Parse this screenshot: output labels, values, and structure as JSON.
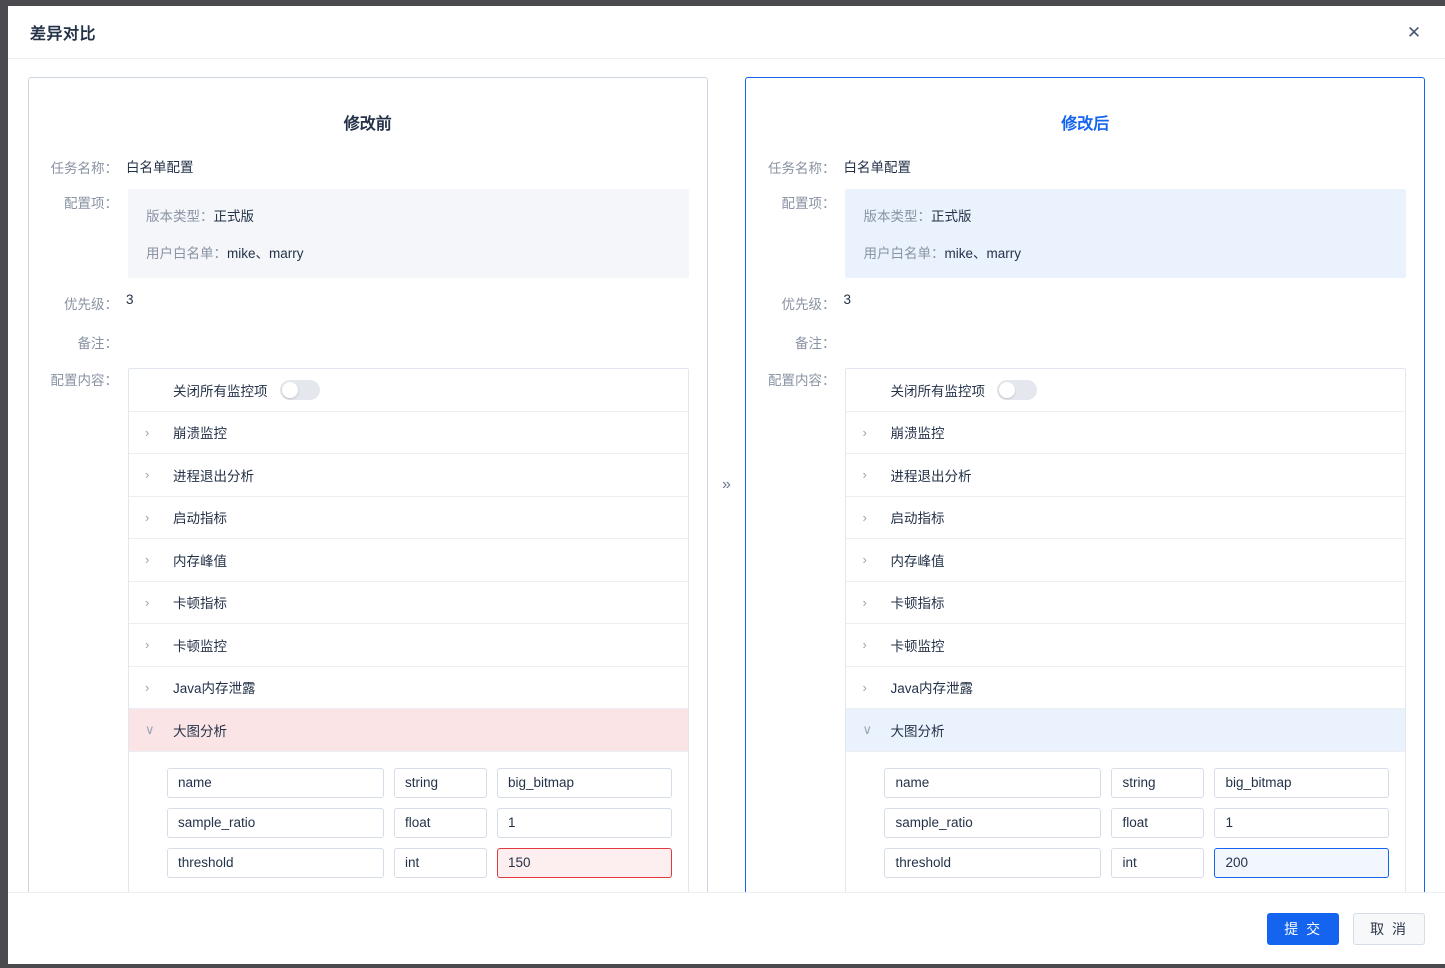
{
  "dialog": {
    "title": "差异对比",
    "close_icon": "close-icon",
    "separator_icon": "double-chevron-right-icon"
  },
  "footer": {
    "submit_label": "提 交",
    "cancel_label": "取 消"
  },
  "colors": {
    "accent_blue": "#1464f0",
    "diff_removed_bg": "#fbe4e6",
    "diff_removed_border": "#e0393e",
    "diff_added_bg": "#eaf2fd",
    "diff_added_border": "#1464f0",
    "label_gray": "#8a93a3",
    "text_dark": "#243248"
  },
  "panels": [
    {
      "id": "before",
      "title": "修改前",
      "fields": [
        {
          "label": "任务名称：",
          "value": "白名单配置"
        }
      ],
      "config_items_label": "配置项：",
      "config_items": [
        {
          "key": "版本类型：",
          "value": "正式版"
        },
        {
          "key": "用户白名单：",
          "value": "mike、marry"
        }
      ],
      "priority_label": "优先级：",
      "priority_value": "3",
      "remark_label": "备注：",
      "remark_value": "",
      "content_label": "配置内容：",
      "toggle_row": {
        "label": "关闭所有监控项",
        "switch_state": "off"
      },
      "accordion": [
        {
          "label": "崩溃监控",
          "expanded": false
        },
        {
          "label": "进程退出分析",
          "expanded": false
        },
        {
          "label": "启动指标",
          "expanded": false
        },
        {
          "label": "内存峰值",
          "expanded": false
        },
        {
          "label": "卡顿指标",
          "expanded": false
        },
        {
          "label": "卡顿监控",
          "expanded": false
        },
        {
          "label": "Java内存泄露",
          "expanded": false
        },
        {
          "label": "大图分析",
          "expanded": true
        }
      ],
      "expanded_fields": [
        {
          "name": "name",
          "type": "string",
          "value": "big_bitmap",
          "changed": false
        },
        {
          "name": "sample_ratio",
          "type": "float",
          "value": "1",
          "changed": false
        },
        {
          "name": "threshold",
          "type": "int",
          "value": "150",
          "changed": true
        }
      ]
    },
    {
      "id": "after",
      "title": "修改后",
      "fields": [
        {
          "label": "任务名称：",
          "value": "白名单配置"
        }
      ],
      "config_items_label": "配置项：",
      "config_items": [
        {
          "key": "版本类型：",
          "value": "正式版"
        },
        {
          "key": "用户白名单：",
          "value": "mike、marry"
        }
      ],
      "priority_label": "优先级：",
      "priority_value": "3",
      "remark_label": "备注：",
      "remark_value": "",
      "content_label": "配置内容：",
      "toggle_row": {
        "label": "关闭所有监控项",
        "switch_state": "off"
      },
      "accordion": [
        {
          "label": "崩溃监控",
          "expanded": false
        },
        {
          "label": "进程退出分析",
          "expanded": false
        },
        {
          "label": "启动指标",
          "expanded": false
        },
        {
          "label": "内存峰值",
          "expanded": false
        },
        {
          "label": "卡顿指标",
          "expanded": false
        },
        {
          "label": "卡顿监控",
          "expanded": false
        },
        {
          "label": "Java内存泄露",
          "expanded": false
        },
        {
          "label": "大图分析",
          "expanded": true
        }
      ],
      "expanded_fields": [
        {
          "name": "name",
          "type": "string",
          "value": "big_bitmap",
          "changed": false
        },
        {
          "name": "sample_ratio",
          "type": "float",
          "value": "1",
          "changed": false
        },
        {
          "name": "threshold",
          "type": "int",
          "value": "200",
          "changed": true
        }
      ]
    }
  ]
}
